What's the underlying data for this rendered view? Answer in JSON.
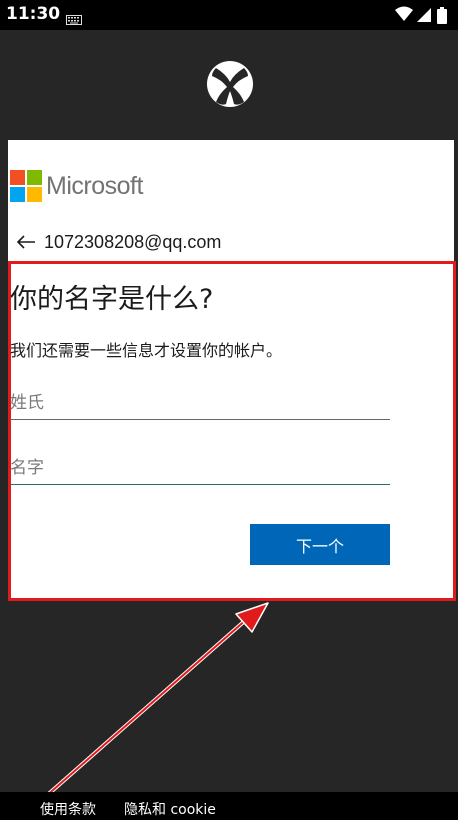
{
  "status_bar": {
    "time": "11:30",
    "icons": [
      "keyboard-icon",
      "wifi-icon",
      "signal-icon",
      "battery-icon"
    ]
  },
  "header": {
    "logo_icon": "xbox-logo-icon"
  },
  "card": {
    "brand_name": "Microsoft",
    "account_email": "1072308208@qq.com",
    "title": "你的名字是什么?",
    "description": "我们还需要一些信息才设置你的帐户。",
    "last_name_placeholder": "姓氏",
    "first_name_placeholder": "名字",
    "last_name_value": "",
    "first_name_value": "",
    "next_label": "下一个"
  },
  "footer": {
    "terms_label": "使用条款",
    "privacy_label": "隐私和 cookie"
  },
  "colors": {
    "accent": "#0067b8",
    "annotation": "#e11b1b",
    "ms_red": "#f25022",
    "ms_green": "#7fba00",
    "ms_blue": "#00a4ef",
    "ms_yellow": "#ffb900"
  }
}
